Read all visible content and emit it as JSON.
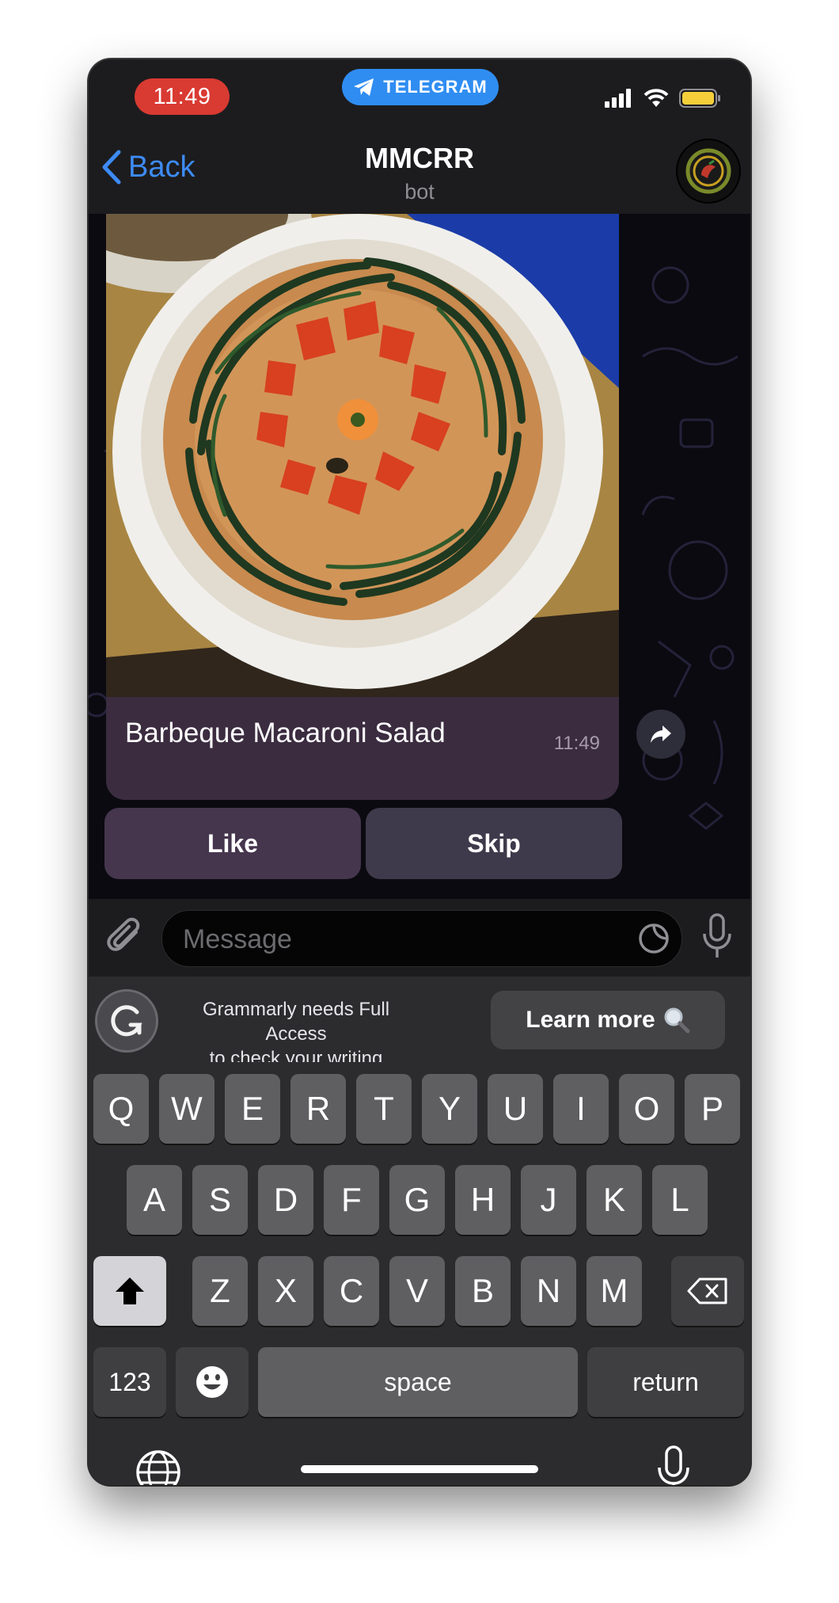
{
  "status_bar": {
    "time": "11:49",
    "telegram_label": "TELEGRAM",
    "icons": [
      "signal-icon",
      "wifi-icon",
      "battery-icon"
    ]
  },
  "nav": {
    "back_label": "Back",
    "title": "MMCRR",
    "subtitle": "bot"
  },
  "message": {
    "caption": "Barbeque Macaroni Salad",
    "time": "11:49",
    "buttons": [
      {
        "label": "Like"
      },
      {
        "label": "Skip"
      }
    ]
  },
  "input": {
    "placeholder": "Message"
  },
  "grammarly": {
    "text_line1": "Grammarly needs Full Access",
    "text_line2": "to check your writing",
    "learn_more": "Learn more"
  },
  "keyboard": {
    "row1": [
      "Q",
      "W",
      "E",
      "R",
      "T",
      "Y",
      "U",
      "I",
      "O",
      "P"
    ],
    "row2": [
      "A",
      "S",
      "D",
      "F",
      "G",
      "H",
      "J",
      "K",
      "L"
    ],
    "row3": [
      "Z",
      "X",
      "C",
      "V",
      "B",
      "N",
      "M"
    ],
    "numbers_label": "123",
    "space_label": "space",
    "return_label": "return"
  },
  "colors": {
    "accent": "#3d8bf5",
    "time_pill": "#d93a32",
    "telegram_pill": "#2f8df2",
    "bubble": "#3b2c40"
  }
}
